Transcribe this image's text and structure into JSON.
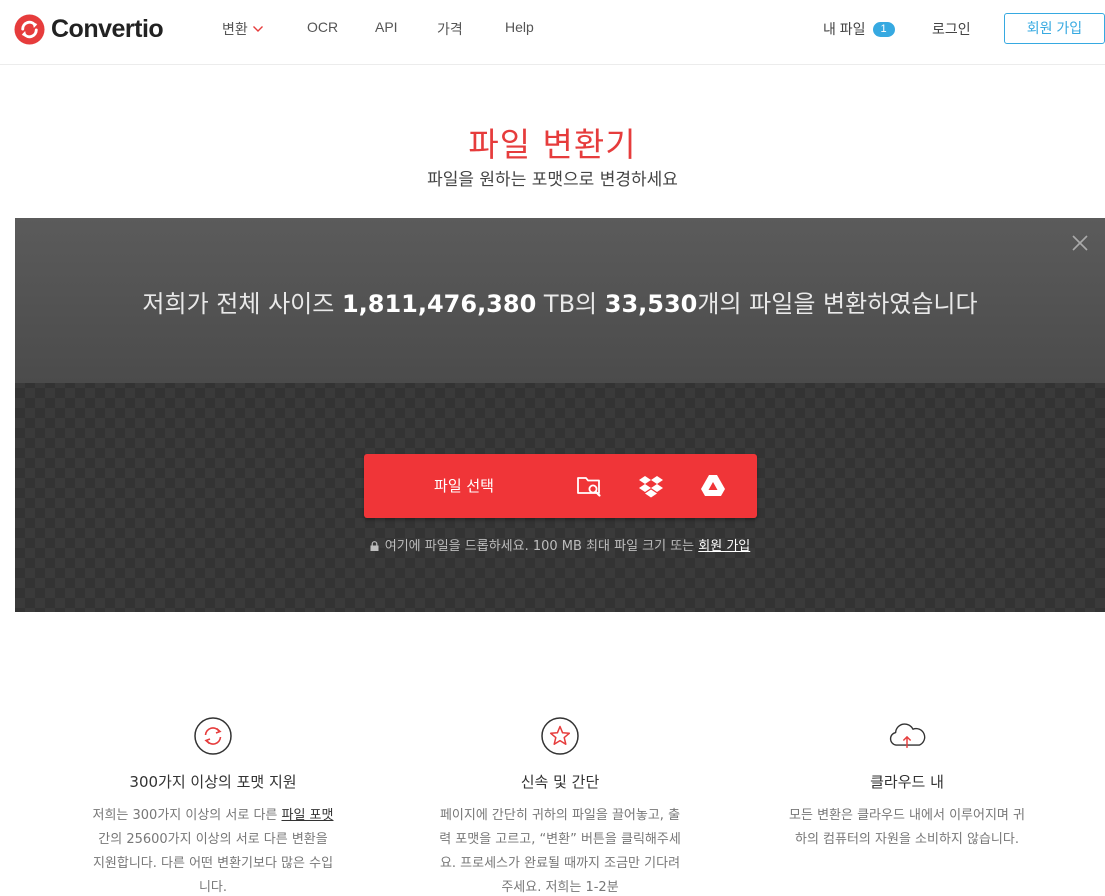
{
  "brand": {
    "name": "Convertio",
    "accent": "#e63c3c",
    "link_blue": "#36a9e1"
  },
  "nav": {
    "items": [
      {
        "label": "변환",
        "has_dropdown": true
      },
      {
        "label": "OCR"
      },
      {
        "label": "API"
      },
      {
        "label": "가격"
      },
      {
        "label": "Help"
      }
    ],
    "my_files_label": "내 파일",
    "my_files_count": "1",
    "login_label": "로그인",
    "signup_label": "회원 가입"
  },
  "hero": {
    "title": "파일 변환기",
    "subtitle": "파일을 원하는 포맷으로 변경하세요"
  },
  "converter": {
    "stats_prefix": "저희가 전체 사이즈 ",
    "stats_size": "1,811,476,380",
    "stats_unit": " TB의 ",
    "stats_files": "33,530",
    "stats_suffix": "개의 파일을 변환하였습니다",
    "choose_files_label": "파일 선택",
    "upload_icons": [
      "folder-search-icon",
      "dropbox-icon",
      "google-drive-icon"
    ],
    "drop_note": "여기에 파일을 드롭하세요. 100 MB 최대 파일 크기 또는 ",
    "drop_note_link": "회원 가입"
  },
  "features": [
    {
      "icon": "refresh-icon",
      "title": "300가지 이상의 포맷 지원",
      "body_pre": "저희는 300가지 이상의 서로 다른 ",
      "body_link": "파일 포맷",
      "body_post": " 간의 25600가지 이상의 서로 다른 변환을 지원합니다. 다른 어떤 변환기보다 많은 수입니다."
    },
    {
      "icon": "star-icon",
      "title": "신속 및 간단",
      "body": "페이지에 간단히 귀하의 파일을 끌어놓고, 출력 포맷을 고르고, “변환” 버튼을 클릭해주세요. 프로세스가 완료될 때까지 조금만 기다려주세요. 저희는 1-2분"
    },
    {
      "icon": "cloud-upload-icon",
      "title": "클라우드 내",
      "body": "모든 변환은 클라우드 내에서 이루어지며 귀하의 컴퓨터의 자원을 소비하지 않습니다."
    }
  ]
}
